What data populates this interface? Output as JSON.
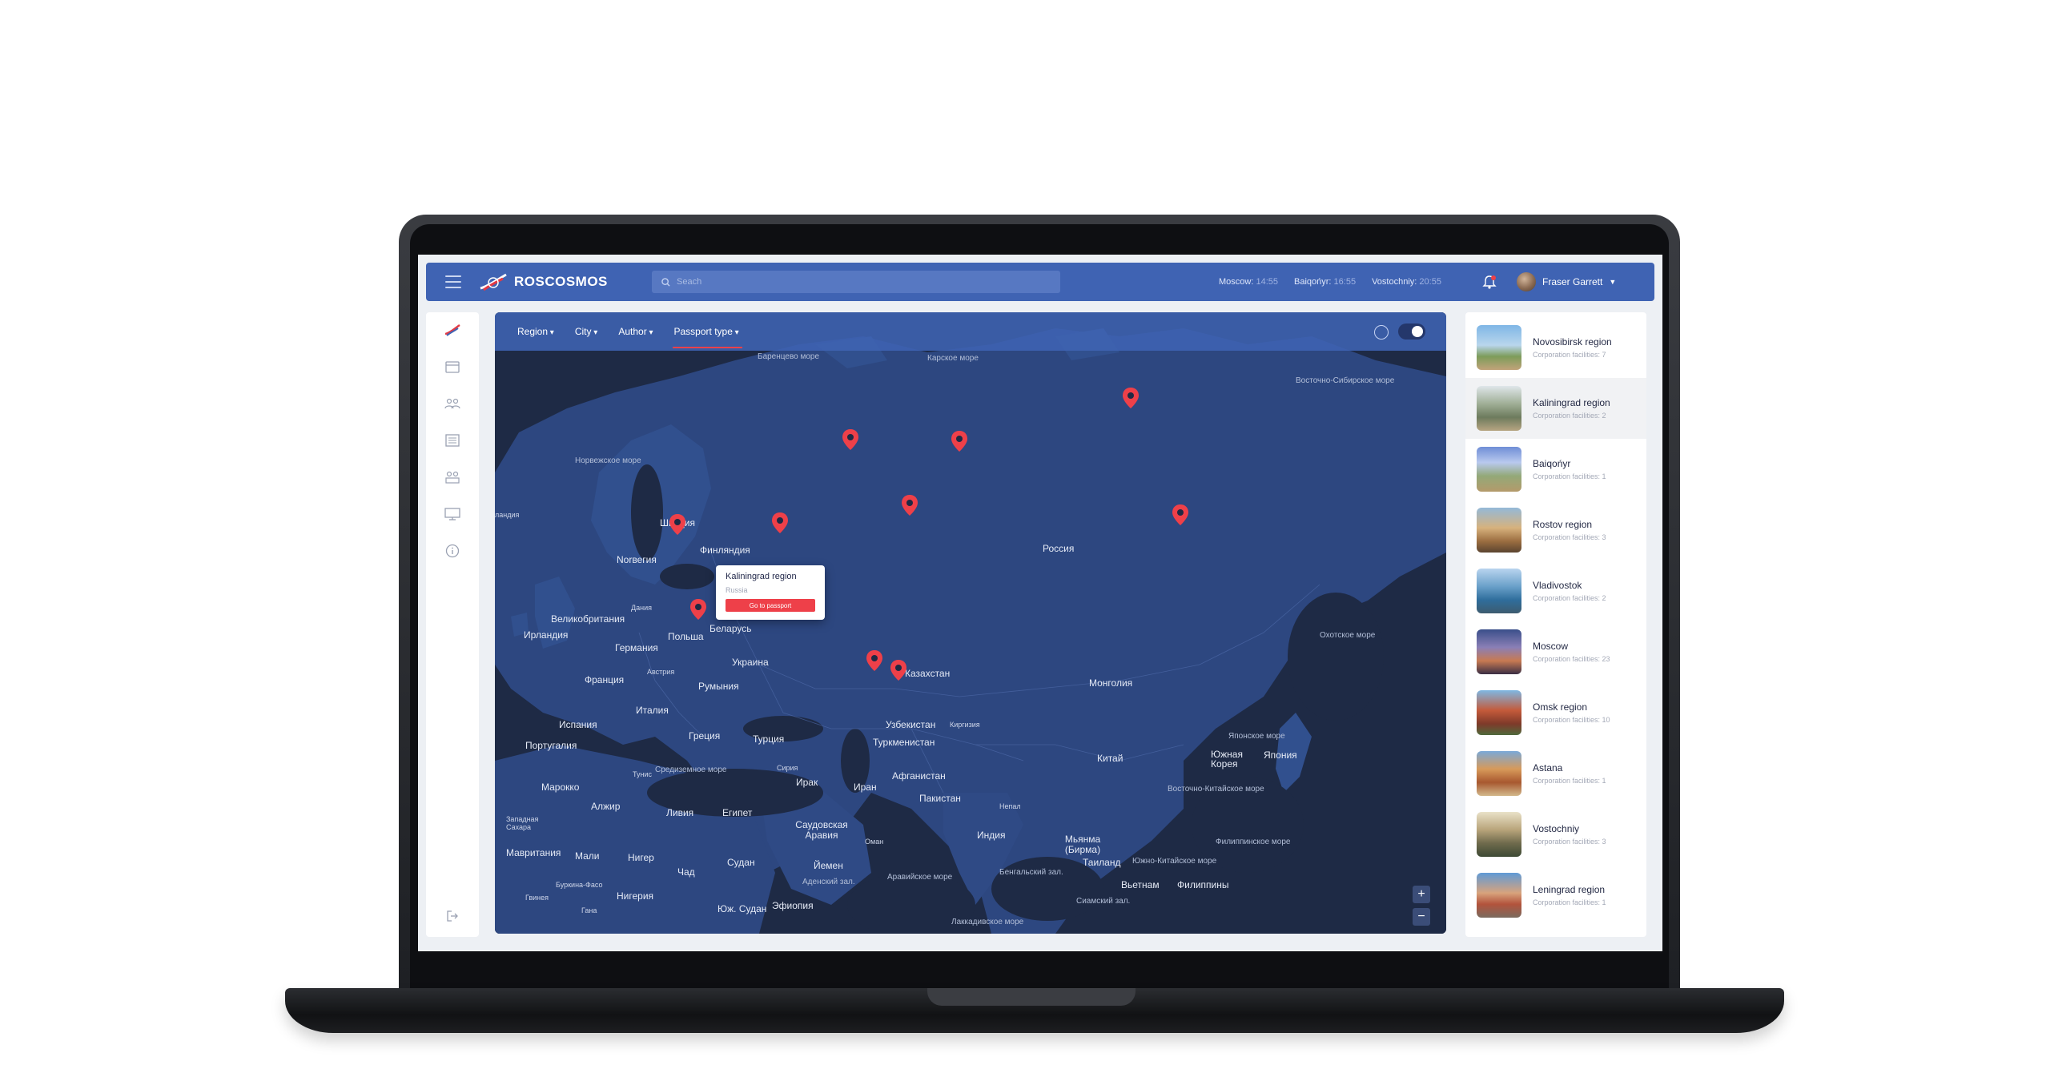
{
  "header": {
    "brand": "ROSCOSMOS",
    "search_placeholder": "Seach",
    "clocks": [
      {
        "city": "Moscow:",
        "time": "14:55"
      },
      {
        "city": "Baiqońyr:",
        "time": "16:55"
      },
      {
        "city": "Vostochniy:",
        "time": "20:55"
      }
    ],
    "user_name": "Fraser Garrett"
  },
  "filters": {
    "region": "Region",
    "city": "City",
    "author": "Author",
    "passport_type": "Passport type"
  },
  "map": {
    "labels": {
      "barents": "Баренцево море",
      "kara": "Карское море",
      "east_siberian": "Восточно-Сибирское море",
      "norwegian": "Норвежское море",
      "iceland": "ландия",
      "sweden": "Швеция",
      "finland": "Финляндия",
      "norway": "Norвегия",
      "russia": "Россия",
      "uk": "Великобритания",
      "ireland": "Ирландия",
      "denmark": "Дания",
      "poland": "Польша",
      "belarus": "Беларусь",
      "germany": "Германия",
      "ukraine": "Украина",
      "austria": "Австрия",
      "france": "Франция",
      "romania": "Румыния",
      "kazakhstan": "Казахстан",
      "mongolia": "Монголия",
      "okhotsk": "Охотское море",
      "italy": "Италия",
      "spain": "Испания",
      "portugal": "Португалия",
      "greece": "Греция",
      "turkey": "Турция",
      "uzbekistan": "Узбекистан",
      "kyrgyzstan": "Киргизия",
      "turkmenistan": "Туркменистан",
      "japan_sea": "Японское море",
      "s_korea": "Южная Корея",
      "japan": "Япония",
      "china": "Китай",
      "morocco": "Марокко",
      "tunisia": "Тунис",
      "mediterranean": "Средиземное море",
      "syria": "Сирия",
      "iraq": "Ирак",
      "iran": "Иран",
      "afghanistan": "Афганистан",
      "pakistan": "Пакистан",
      "nepal": "Непал",
      "e_china_sea": "Восточно-Китайское море",
      "algeria": "Алжир",
      "libya": "Ливия",
      "egypt": "Египет",
      "w_sahara": "Западная Сахара",
      "saudi": "Саудовская Аравия",
      "india": "Индия",
      "myanmar": "Мьянма (Бирма)",
      "oman": "Оман",
      "philippine_sea": "Филиппинское море",
      "mauritania": "Мавритания",
      "mali": "Мали",
      "niger": "Нигер",
      "chad": "Чад",
      "sudan": "Судан",
      "yemen": "Йемен",
      "thailand": "Таиланд",
      "scs": "Южно-Китайское море",
      "bengal": "Бенгальский зал.",
      "aden": "Аденский зал.",
      "arabian": "Аравийское море",
      "vietnam": "Вьетнам",
      "philippines": "Филиппины",
      "burkina": "Буркина-Фасо",
      "guinea": "Гвинея",
      "nigeria": "Нигерия",
      "ghana": "Гана",
      "s_sudan": "Юж. Судан",
      "ethiopia": "Эфиопия",
      "siam": "Сиамский зал.",
      "laccadive": "Лаккадивское море"
    },
    "popup": {
      "title": "Kaliningrad region",
      "country": "Russia",
      "button": "Go to passport"
    },
    "zoom_in": "+",
    "zoom_out": "−"
  },
  "regions": [
    {
      "name": "Novosibirsk region",
      "facilities": "Corporation facilities: 7"
    },
    {
      "name": "Kaliningrad region",
      "facilities": "Corporation facilities: 2"
    },
    {
      "name": "Baiqońyr",
      "facilities": "Corporation facilities: 1"
    },
    {
      "name": "Rostov region",
      "facilities": "Corporation facilities: 3"
    },
    {
      "name": "Vladivostok",
      "facilities": "Corporation facilities: 2"
    },
    {
      "name": "Moscow",
      "facilities": "Corporation facilities: 23"
    },
    {
      "name": "Omsk region",
      "facilities": "Corporation facilities: 10"
    },
    {
      "name": "Astana",
      "facilities": "Corporation facilities: 1"
    },
    {
      "name": "Vostochniy",
      "facilities": "Corporation facilities: 3"
    },
    {
      "name": "Leningrad region",
      "facilities": "Corporation facilities: 1"
    }
  ],
  "colors": {
    "accent": "#3f63b3",
    "map_water": "#1e2a45",
    "map_land": "#2e4a84",
    "pin": "#ee4049"
  }
}
